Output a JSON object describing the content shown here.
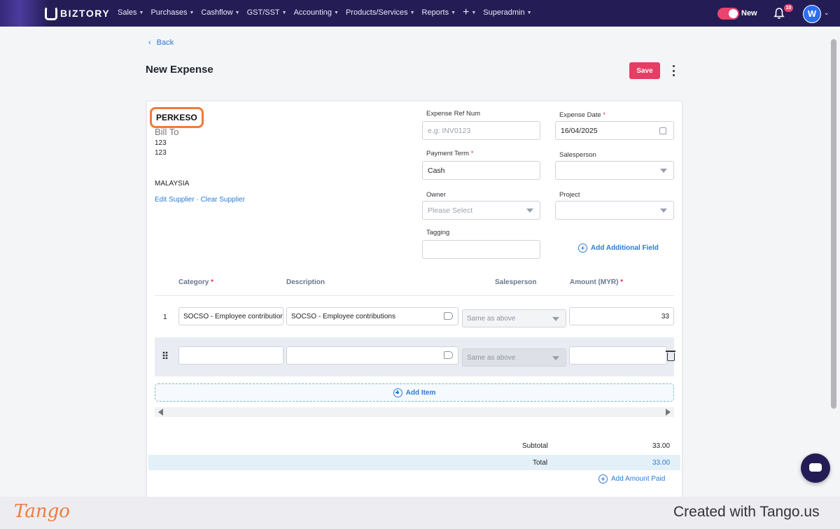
{
  "nav": {
    "brand": "BIZTORY",
    "menu": [
      {
        "label": "Sales"
      },
      {
        "label": "Purchases"
      },
      {
        "label": "Cashflow"
      },
      {
        "label": "GST/SST"
      },
      {
        "label": "Accounting"
      },
      {
        "label": "Products/Services"
      },
      {
        "label": "Reports"
      },
      {
        "label": "+"
      },
      {
        "label": "Superadmin"
      }
    ],
    "toggle_label": "New",
    "notifications_count": "10",
    "avatar_initial": "W",
    "accent_color": "#e9456f",
    "bg_color": "#241d55"
  },
  "page": {
    "back_label": "Back",
    "title": "New Expense",
    "save_label": "Save"
  },
  "supplier": {
    "name": "PERKESO",
    "bill_to_label": "Bill To",
    "address_line1": "123",
    "address_line2": "123",
    "country": "MALAYSIA",
    "links": "Edit Supplier · Clear Supplier"
  },
  "form": {
    "expense_ref": {
      "label": "Expense Ref Num",
      "placeholder": "e.g: INV0123",
      "value": ""
    },
    "expense_date": {
      "label": "Expense Date",
      "value": "16/04/2025"
    },
    "payment_term": {
      "label": "Payment Term",
      "value": "Cash"
    },
    "salesperson": {
      "label": "Salesperson",
      "value": ""
    },
    "owner": {
      "label": "Owner",
      "placeholder": "Please Select"
    },
    "project": {
      "label": "Project",
      "value": ""
    },
    "tagging": {
      "label": "Tagging",
      "value": ""
    },
    "add_field_label": "Add Additional Field"
  },
  "items": {
    "headers": {
      "category": "Category",
      "description": "Description",
      "salesperson": "Salesperson",
      "amount": "Amount (MYR)"
    },
    "rows": [
      {
        "num": "1",
        "category": "SOCSO - Employee contribution",
        "description": "SOCSO - Employee contributions",
        "salesperson": "Same as above",
        "amount": "33"
      },
      {
        "num": "",
        "category": "",
        "description": "",
        "salesperson": "Same as above",
        "amount": ""
      }
    ],
    "add_item_label": "Add Item"
  },
  "totals": {
    "subtotal_label": "Subtotal",
    "subtotal_value": "33.00",
    "total_label": "Total",
    "total_value": "33.00",
    "add_paid_label": "Add Amount Paid"
  },
  "footer": {
    "logo_text": "Tango",
    "created_with": "Created with Tango.us"
  }
}
